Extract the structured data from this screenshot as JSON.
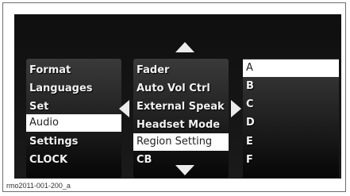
{
  "left_menu": {
    "items": [
      {
        "label": "Format",
        "selected": false
      },
      {
        "label": "Languages",
        "selected": false
      },
      {
        "label": "Set",
        "selected": false
      },
      {
        "label": "Audio",
        "selected": true
      },
      {
        "label": "Settings",
        "selected": false
      },
      {
        "label": "CLOCK",
        "selected": false
      }
    ]
  },
  "middle_menu": {
    "items": [
      {
        "label": "Fader",
        "selected": false
      },
      {
        "label": "Auto Vol Ctrl",
        "selected": false
      },
      {
        "label": "External Speak",
        "selected": false
      },
      {
        "label": "Headset Mode",
        "selected": false
      },
      {
        "label": "Region Setting",
        "selected": true
      },
      {
        "label": "CB",
        "selected": false
      }
    ]
  },
  "right_menu": {
    "items": [
      {
        "label": "A",
        "selected": true
      },
      {
        "label": "B",
        "selected": false
      },
      {
        "label": "C",
        "selected": false
      },
      {
        "label": "D",
        "selected": false
      },
      {
        "label": "E",
        "selected": false
      },
      {
        "label": "F",
        "selected": false
      }
    ]
  },
  "icons": {
    "up": "arrow-up-icon",
    "down": "arrow-down-icon",
    "left": "arrow-left-icon",
    "right": "arrow-right-icon"
  },
  "colors": {
    "selection": "#ffffff",
    "menu_text": "#f2f2f2",
    "screen_background": "#121212"
  },
  "caption": "rmo2011-001-200_a"
}
